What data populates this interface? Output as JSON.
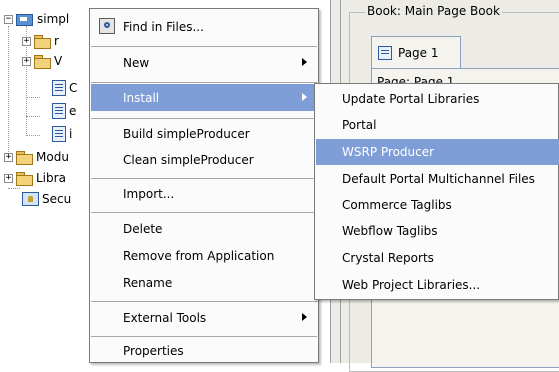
{
  "tree": {
    "items": [
      {
        "label": "simpl",
        "icon": "project-icon"
      },
      {
        "label": "r",
        "icon": "folder-icon"
      },
      {
        "label": "V",
        "icon": "folder-icon"
      },
      {
        "label": "C",
        "icon": "file-icon"
      },
      {
        "label": "e",
        "icon": "file-icon"
      },
      {
        "label": "i",
        "icon": "file-icon"
      },
      {
        "label": "Modu",
        "icon": "folder-icon"
      },
      {
        "label": "Libra",
        "icon": "folder-icon"
      },
      {
        "label": "Secu",
        "icon": "security-icon"
      }
    ]
  },
  "editor": {
    "group_title": "Book: Main Page Book",
    "tab_label": "Page 1",
    "page_label": "Page: Page 1"
  },
  "context_menu": {
    "items": [
      {
        "label": "Find in Files...",
        "icon": "find-in-files-icon"
      },
      {
        "label": "New",
        "submenu": true
      },
      {
        "label": "Install",
        "submenu": true,
        "highlighted": true
      },
      {
        "label": "Build simpleProducer"
      },
      {
        "label": "Clean simpleProducer"
      },
      {
        "label": "Import..."
      },
      {
        "label": "Delete"
      },
      {
        "label": "Remove from Application"
      },
      {
        "label": "Rename"
      },
      {
        "label": "External Tools",
        "submenu": true
      },
      {
        "label": "Properties"
      }
    ]
  },
  "install_submenu": {
    "items": [
      {
        "label": "Update Portal Libraries"
      },
      {
        "label": "Portal"
      },
      {
        "label": "WSRP Producer",
        "highlighted": true
      },
      {
        "label": "Default Portal Multichannel Files"
      },
      {
        "label": "Commerce Taglibs"
      },
      {
        "label": "Webflow Taglibs"
      },
      {
        "label": "Crystal Reports"
      },
      {
        "label": "Web Project Libraries..."
      }
    ]
  },
  "colors": {
    "highlight": "#7f9ed8",
    "panel": "#ecebe5"
  }
}
